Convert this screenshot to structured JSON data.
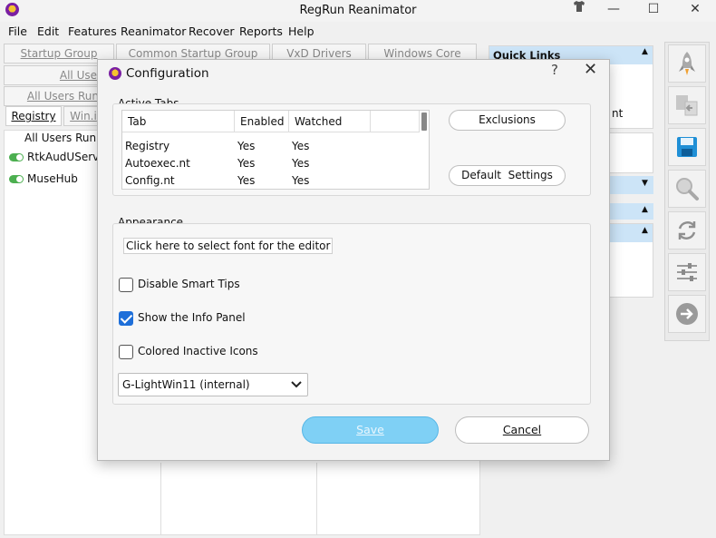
{
  "window": {
    "title": "RegRun Reanimator",
    "minimize": "—",
    "maximize": "☐",
    "close": "✕",
    "extra_icon": "shirt-icon"
  },
  "menu": [
    "File",
    "Edit",
    "Features",
    "Reanimator",
    "Recover",
    "Reports",
    "Help"
  ],
  "bg_tabs": {
    "row1": [
      "Startup Group",
      "Common Startup Group",
      "VxD Drivers",
      "Windows Core"
    ],
    "row2": [
      "All Use"
    ],
    "row3": [
      "All Users Run"
    ],
    "row4": [
      "Registry",
      "Win.i"
    ]
  },
  "left_list": {
    "header": "All Users Run",
    "items": [
      "RtkAudUServic",
      "MuseHub"
    ]
  },
  "right_panel": {
    "quick_links": "Quick Links",
    "partial_text": "nt"
  },
  "dialog": {
    "title": "Configuration",
    "help": "?",
    "close": "✕",
    "active_tabs": {
      "label": "Active Tabs",
      "columns": [
        "Tab",
        "Enabled",
        "Watched"
      ],
      "rows": [
        {
          "tab": "Registry",
          "enabled": "Yes",
          "watched": "Yes"
        },
        {
          "tab": "Autoexec.nt",
          "enabled": "Yes",
          "watched": "Yes"
        },
        {
          "tab": "Config.nt",
          "enabled": "Yes",
          "watched": "Yes"
        }
      ]
    },
    "exclusions_button": "Exclusions",
    "default_settings_button": "Default  Settings",
    "appearance": {
      "label": "Appearance",
      "font_link": "Click here to select font for the editor",
      "checkboxes": [
        {
          "label": "Disable Smart Tips",
          "checked": false
        },
        {
          "label": "Show the Info Panel",
          "checked": true
        },
        {
          "label": "Colored Inactive Icons",
          "checked": false
        }
      ],
      "skin_selected": "G-LightWin11 (internal)"
    },
    "save_button": "Save",
    "cancel_button": "Cancel"
  },
  "side_toolbar": {
    "icons": [
      "rocket-icon",
      "copy-icon",
      "save-icon",
      "search-icon",
      "refresh-icon",
      "settings-sliders-icon",
      "next-arrow-icon"
    ]
  },
  "colors": {
    "accent": "#1e6fd9",
    "save_button": "#7fd0f5",
    "panel_header": "#cce4f7"
  }
}
